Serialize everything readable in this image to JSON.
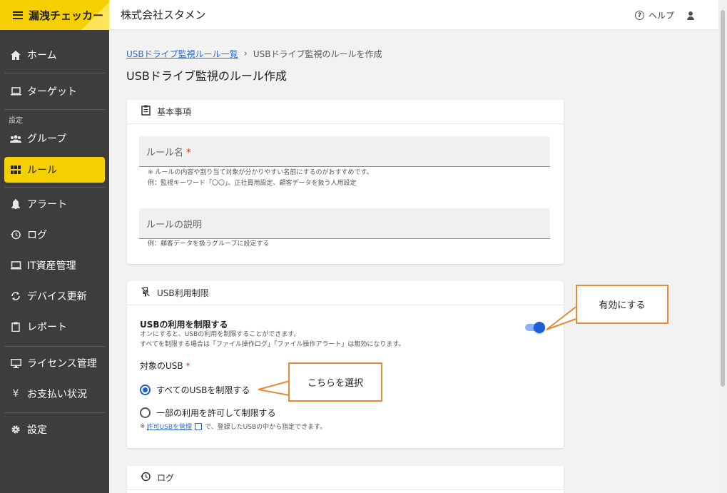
{
  "brand": {
    "title": "漏洩チェッカー"
  },
  "header": {
    "company": "株式会社スタメン",
    "help_label": "ヘルプ"
  },
  "sidebar": {
    "section_label": "設定",
    "items": [
      {
        "label": "ホーム",
        "icon": "home-icon"
      },
      {
        "label": "ターゲット",
        "icon": "laptop-icon"
      },
      {
        "label": "グループ",
        "icon": "group-icon"
      },
      {
        "label": "ルール",
        "icon": "grid-icon",
        "active": true
      },
      {
        "label": "アラート",
        "icon": "bell-icon"
      },
      {
        "label": "ログ",
        "icon": "history-icon"
      },
      {
        "label": "IT資産管理",
        "icon": "computer-icon"
      },
      {
        "label": "デバイス更新",
        "icon": "sync-icon"
      },
      {
        "label": "レポート",
        "icon": "clipboard-icon"
      },
      {
        "label": "ライセンス管理",
        "icon": "monitor-icon"
      },
      {
        "label": "お支払い状況",
        "icon": "yen-icon"
      },
      {
        "label": "設定",
        "icon": "gear-icon"
      }
    ]
  },
  "breadcrumb": {
    "parent": "USBドライブ監視ルール一覧",
    "current": "USBドライブ監視のルールを作成"
  },
  "page": {
    "title": "USBドライブ監視のルール作成"
  },
  "basic": {
    "header": "基本事項",
    "rule_name_label": "ルール名",
    "rule_name_required": "*",
    "rule_name_hint_1": "※ ルールの内容や割り当て対象が分かりやすい名前にするのがおすすめです。",
    "rule_name_hint_2": "例：監視キーワード「〇〇」、正社員用設定、顧客データを扱う人用設定",
    "desc_label": "ルールの説明",
    "desc_hint": "例：顧客データを扱うグループに設定する"
  },
  "usb": {
    "header": "USB利用制限",
    "switch_title": "USBの利用を制限する",
    "switch_desc_1": "オンにすると、USBの利用を制限することができます。",
    "switch_desc_2": "すべてを制限する場合は「ファイル操作ログ」「ファイル操作アラート」は無効になります。",
    "switch_on": true,
    "target_label": "対象のUSB",
    "target_required": "*",
    "option_all": "すべてのUSBを制限する",
    "option_partial": "一部の利用を許可して制限する",
    "note_prefix": "※",
    "note_link": "許可USBを管理",
    "note_suffix": "で、登録したUSBの中から指定できます。"
  },
  "log": {
    "header": "ログ"
  },
  "callouts": {
    "enable": "有効にする",
    "select": "こちらを選択"
  },
  "colors": {
    "accent": "#f6cf00",
    "primary": "#1a5fd6",
    "callout_border": "#e58a36"
  }
}
